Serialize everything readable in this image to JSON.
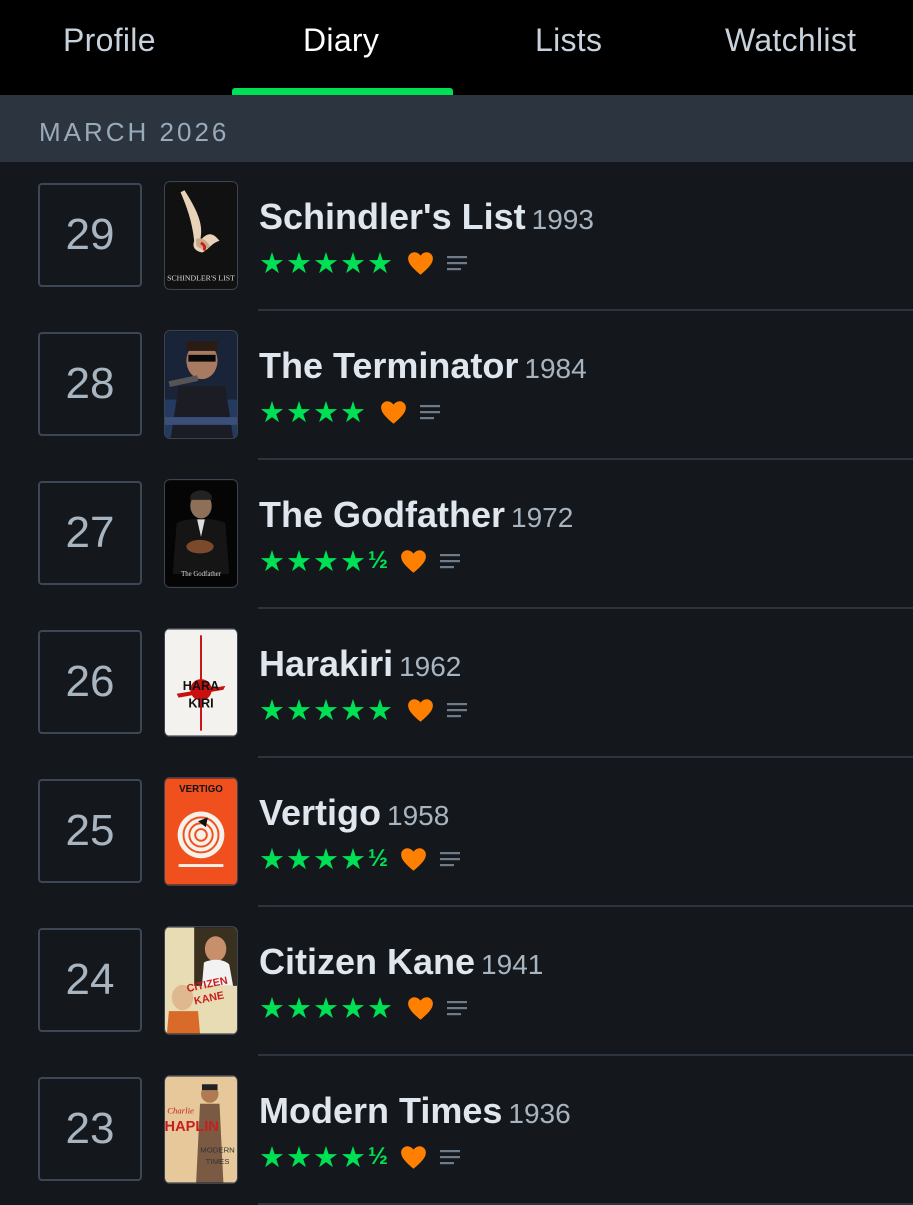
{
  "tabs": [
    {
      "label": "Profile"
    },
    {
      "label": "Diary"
    },
    {
      "label": "Lists"
    },
    {
      "label": "Watchlist"
    }
  ],
  "active_tab": "Diary",
  "month": "MARCH 2026",
  "colors": {
    "accent": "#00e054",
    "heart": "#ff8000",
    "background": "#14181c",
    "header": "#2c3440"
  },
  "entries": [
    {
      "day": "29",
      "title": "Schindler's List",
      "year": "1993",
      "stars": "★★★★★",
      "half": "",
      "rating": 5,
      "liked": true,
      "has_review": true,
      "poster_text": "SCHINDLER'S LIST"
    },
    {
      "day": "28",
      "title": "The Terminator",
      "year": "1984",
      "stars": "★★★★",
      "half": "",
      "rating": 4,
      "liked": true,
      "has_review": true,
      "poster_text": ""
    },
    {
      "day": "27",
      "title": "The Godfather",
      "year": "1972",
      "stars": "★★★★",
      "half": "½",
      "rating": 4.5,
      "liked": true,
      "has_review": true,
      "poster_text": "The Godfather"
    },
    {
      "day": "26",
      "title": "Harakiri",
      "year": "1962",
      "stars": "★★★★★",
      "half": "",
      "rating": 5,
      "liked": true,
      "has_review": true,
      "poster_text": "HARAKIRI"
    },
    {
      "day": "25",
      "title": "Vertigo",
      "year": "1958",
      "stars": "★★★★",
      "half": "½",
      "rating": 4.5,
      "liked": true,
      "has_review": true,
      "poster_text": "VERTIGO"
    },
    {
      "day": "24",
      "title": "Citizen Kane",
      "year": "1941",
      "stars": "★★★★★",
      "half": "",
      "rating": 5,
      "liked": true,
      "has_review": true,
      "poster_text": "CITIZEN KANE"
    },
    {
      "day": "23",
      "title": "Modern Times",
      "year": "1936",
      "stars": "★★★★",
      "half": "½",
      "rating": 4.5,
      "liked": true,
      "has_review": true,
      "poster_text": "Charlie CHAPLIN MODERN TIMES"
    }
  ]
}
